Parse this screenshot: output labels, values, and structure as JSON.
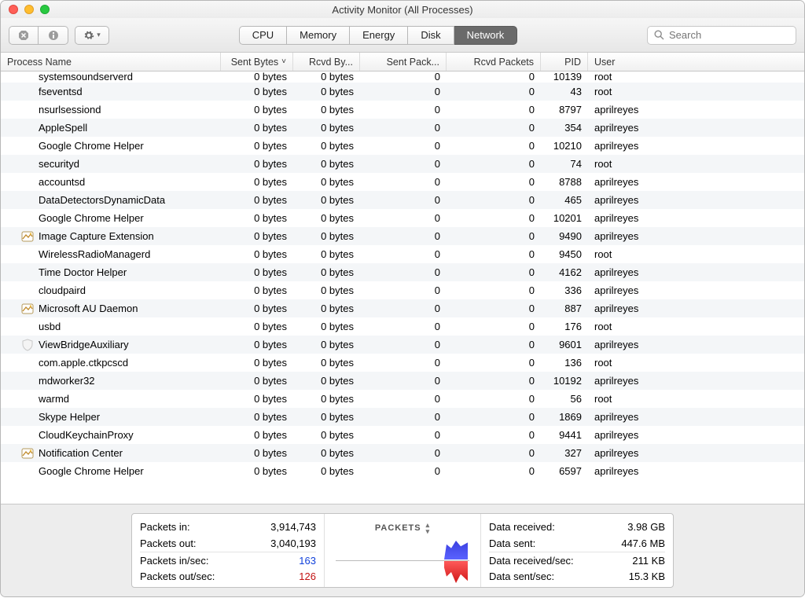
{
  "window": {
    "title": "Activity Monitor (All Processes)"
  },
  "toolbar": {
    "tabs": [
      "CPU",
      "Memory",
      "Energy",
      "Disk",
      "Network"
    ],
    "active_tab": 4,
    "search_placeholder": "Search"
  },
  "columns": {
    "name": "Process Name",
    "sent": "Sent Bytes",
    "rcvd": "Rcvd By...",
    "sp": "Sent Pack...",
    "rp": "Rcvd Packets",
    "pid": "PID",
    "user": "User"
  },
  "processes": [
    {
      "name": "systemsoundserverd",
      "sent": "0 bytes",
      "rcvd": "0 bytes",
      "sp": "0",
      "rp": "0",
      "pid": "10139",
      "user": "root",
      "cut": true
    },
    {
      "name": "fseventsd",
      "sent": "0 bytes",
      "rcvd": "0 bytes",
      "sp": "0",
      "rp": "0",
      "pid": "43",
      "user": "root"
    },
    {
      "name": "nsurlsessiond",
      "sent": "0 bytes",
      "rcvd": "0 bytes",
      "sp": "0",
      "rp": "0",
      "pid": "8797",
      "user": "aprilreyes"
    },
    {
      "name": "AppleSpell",
      "sent": "0 bytes",
      "rcvd": "0 bytes",
      "sp": "0",
      "rp": "0",
      "pid": "354",
      "user": "aprilreyes"
    },
    {
      "name": "Google Chrome Helper",
      "sent": "0 bytes",
      "rcvd": "0 bytes",
      "sp": "0",
      "rp": "0",
      "pid": "10210",
      "user": "aprilreyes"
    },
    {
      "name": "securityd",
      "sent": "0 bytes",
      "rcvd": "0 bytes",
      "sp": "0",
      "rp": "0",
      "pid": "74",
      "user": "root"
    },
    {
      "name": "accountsd",
      "sent": "0 bytes",
      "rcvd": "0 bytes",
      "sp": "0",
      "rp": "0",
      "pid": "8788",
      "user": "aprilreyes"
    },
    {
      "name": "DataDetectorsDynamicData",
      "sent": "0 bytes",
      "rcvd": "0 bytes",
      "sp": "0",
      "rp": "0",
      "pid": "465",
      "user": "aprilreyes"
    },
    {
      "name": "Google Chrome Helper",
      "sent": "0 bytes",
      "rcvd": "0 bytes",
      "sp": "0",
      "rp": "0",
      "pid": "10201",
      "user": "aprilreyes"
    },
    {
      "name": "Image Capture Extension",
      "sent": "0 bytes",
      "rcvd": "0 bytes",
      "sp": "0",
      "rp": "0",
      "pid": "9490",
      "user": "aprilreyes",
      "icon": "image-capture"
    },
    {
      "name": "WirelessRadioManagerd",
      "sent": "0 bytes",
      "rcvd": "0 bytes",
      "sp": "0",
      "rp": "0",
      "pid": "9450",
      "user": "root"
    },
    {
      "name": "Time Doctor Helper",
      "sent": "0 bytes",
      "rcvd": "0 bytes",
      "sp": "0",
      "rp": "0",
      "pid": "4162",
      "user": "aprilreyes"
    },
    {
      "name": "cloudpaird",
      "sent": "0 bytes",
      "rcvd": "0 bytes",
      "sp": "0",
      "rp": "0",
      "pid": "336",
      "user": "aprilreyes"
    },
    {
      "name": "Microsoft AU Daemon",
      "sent": "0 bytes",
      "rcvd": "0 bytes",
      "sp": "0",
      "rp": "0",
      "pid": "887",
      "user": "aprilreyes",
      "icon": "ms-au"
    },
    {
      "name": "usbd",
      "sent": "0 bytes",
      "rcvd": "0 bytes",
      "sp": "0",
      "rp": "0",
      "pid": "176",
      "user": "root"
    },
    {
      "name": "ViewBridgeAuxiliary",
      "sent": "0 bytes",
      "rcvd": "0 bytes",
      "sp": "0",
      "rp": "0",
      "pid": "9601",
      "user": "aprilreyes",
      "icon": "shield"
    },
    {
      "name": "com.apple.ctkpcscd",
      "sent": "0 bytes",
      "rcvd": "0 bytes",
      "sp": "0",
      "rp": "0",
      "pid": "136",
      "user": "root"
    },
    {
      "name": "mdworker32",
      "sent": "0 bytes",
      "rcvd": "0 bytes",
      "sp": "0",
      "rp": "0",
      "pid": "10192",
      "user": "aprilreyes"
    },
    {
      "name": "warmd",
      "sent": "0 bytes",
      "rcvd": "0 bytes",
      "sp": "0",
      "rp": "0",
      "pid": "56",
      "user": "root"
    },
    {
      "name": "Skype Helper",
      "sent": "0 bytes",
      "rcvd": "0 bytes",
      "sp": "0",
      "rp": "0",
      "pid": "1869",
      "user": "aprilreyes"
    },
    {
      "name": "CloudKeychainProxy",
      "sent": "0 bytes",
      "rcvd": "0 bytes",
      "sp": "0",
      "rp": "0",
      "pid": "9441",
      "user": "aprilreyes"
    },
    {
      "name": "Notification Center",
      "sent": "0 bytes",
      "rcvd": "0 bytes",
      "sp": "0",
      "rp": "0",
      "pid": "327",
      "user": "aprilreyes",
      "icon": "notification"
    },
    {
      "name": "Google Chrome Helper",
      "sent": "0 bytes",
      "rcvd": "0 bytes",
      "sp": "0",
      "rp": "0",
      "pid": "6597",
      "user": "aprilreyes"
    }
  ],
  "footer": {
    "left": {
      "packets_in_label": "Packets in:",
      "packets_in": "3,914,743",
      "packets_out_label": "Packets out:",
      "packets_out": "3,040,193",
      "pin_sec_label": "Packets in/sec:",
      "pin_sec": "163",
      "pout_sec_label": "Packets out/sec:",
      "pout_sec": "126"
    },
    "mid_label": "PACKETS",
    "right": {
      "data_rcvd_label": "Data received:",
      "data_rcvd": "3.98 GB",
      "data_sent_label": "Data sent:",
      "data_sent": "447.6 MB",
      "data_rcvd_sec_label": "Data received/sec:",
      "data_rcvd_sec": "211 KB",
      "data_sent_sec_label": "Data sent/sec:",
      "data_sent_sec": "15.3 KB"
    }
  }
}
